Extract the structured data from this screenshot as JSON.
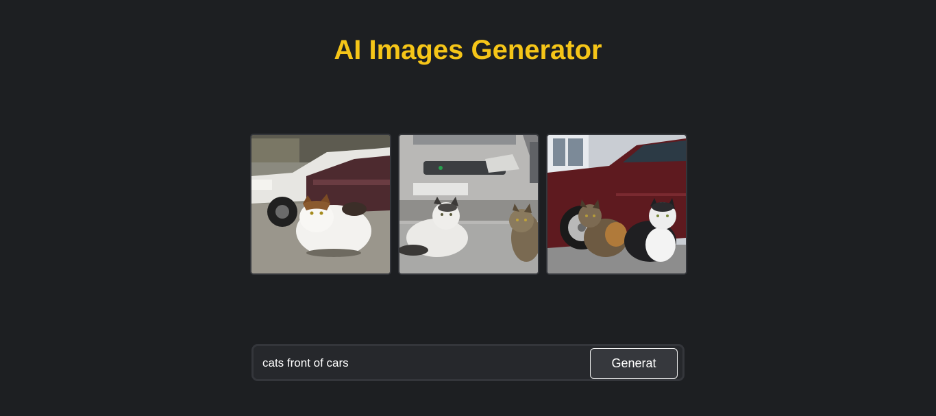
{
  "header": {
    "title": "AI Images Generator"
  },
  "gallery": {
    "images": [
      {
        "subject": "white cat sitting in front of parked cars"
      },
      {
        "subject": "white cat and tabby cat in front of silver car"
      },
      {
        "subject": "tabby cat and black-white cat in front of red car"
      }
    ]
  },
  "prompt": {
    "value": "cats front of cars",
    "button_label": "Generat"
  },
  "colors": {
    "background": "#1d1f22",
    "title": "#f5c518",
    "bar": "#26282c",
    "button": "#36383d"
  }
}
